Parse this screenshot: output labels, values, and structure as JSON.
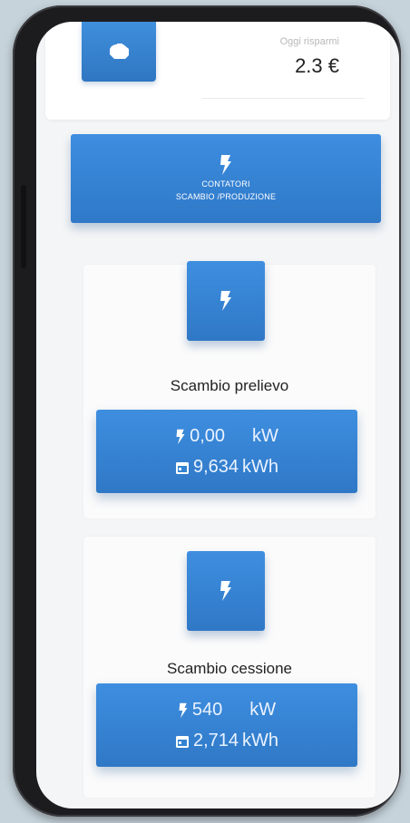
{
  "savings": {
    "label": "Oggi risparmi",
    "value": "2.3 €"
  },
  "banner": {
    "line1": "CONTATORI",
    "line2": "SCAMBIO /PRODUZIONE"
  },
  "meters": [
    {
      "title": "Scambio prelievo",
      "power_value": "0,00",
      "power_unit": "kW",
      "energy_value": "9,634",
      "energy_unit": "kWh"
    },
    {
      "title": "Scambio cessione",
      "power_value": "540",
      "power_unit": "kW",
      "energy_value": "2,714",
      "energy_unit": "kWh"
    }
  ],
  "icons": {
    "savings": "piggy-bank-icon",
    "meter": "lightning-bolt-icon",
    "power": "lightning-bolt-icon",
    "energy": "calendar-icon"
  },
  "colors": {
    "accent": "#3383d3",
    "background": "#c6d3db"
  }
}
